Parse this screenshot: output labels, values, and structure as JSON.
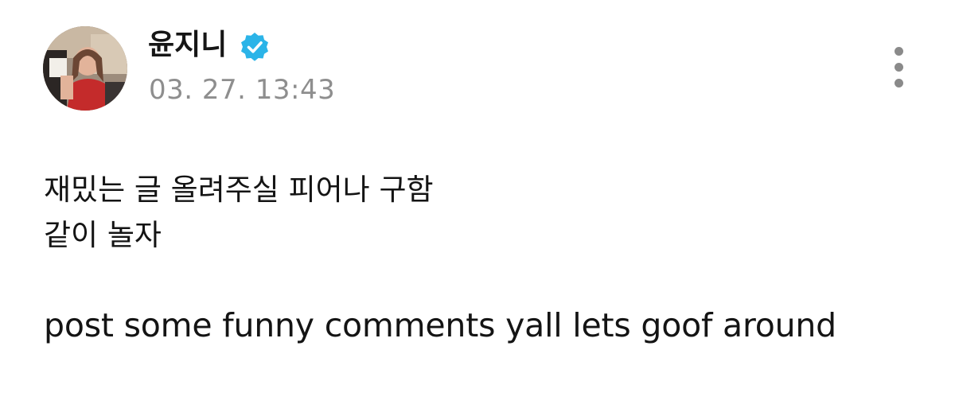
{
  "post": {
    "author": "윤지니",
    "verified": true,
    "timestamp": "03. 27. 13:43",
    "body_lines": [
      "재밌는 글 올려주실 피어나 구함",
      "같이 놀자",
      "post some funny comments yall lets goof around"
    ]
  },
  "icons": {
    "avatar": "profile-photo",
    "verified": "verified-badge-icon",
    "more": "more-vertical-icon"
  },
  "colors": {
    "verified_badge": "#2bb4e8",
    "timestamp": "#8e8e8e",
    "more_icon": "#8a8a8a"
  }
}
